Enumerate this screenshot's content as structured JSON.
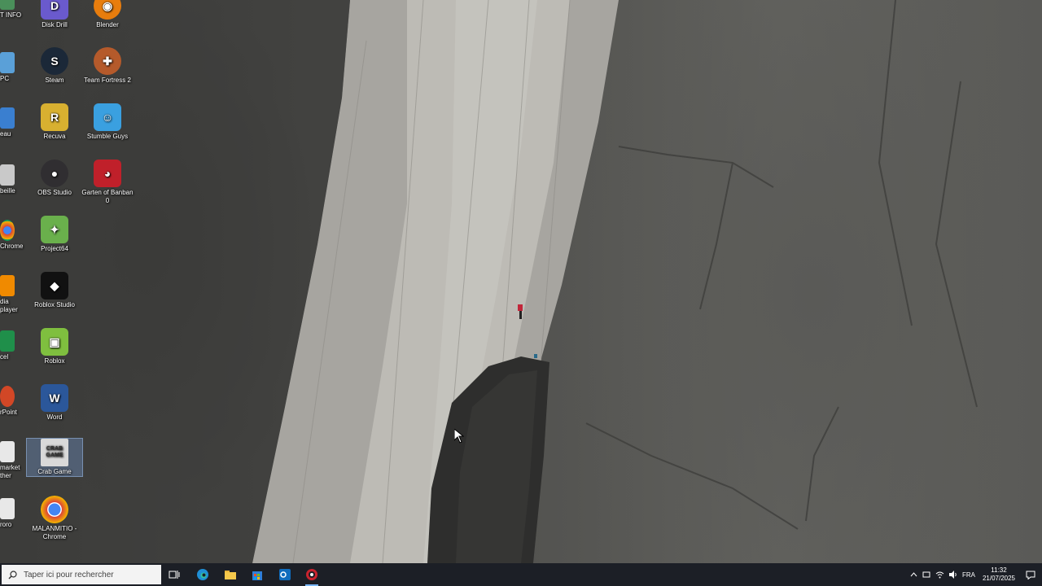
{
  "desktop": {
    "left_clipped": [
      {
        "label": "T INFO",
        "color": "#4a8f5a"
      },
      {
        "label": "PC",
        "color": "#5aa0d8"
      },
      {
        "label": "eau",
        "color": "#3a7fd0"
      },
      {
        "label": "beille",
        "color": "#c9c9c9"
      },
      {
        "label": "Chrome",
        "color": "#db4437"
      },
      {
        "label": "dia player",
        "color": "#f08a00"
      },
      {
        "label": "cel",
        "color": "#1f8f4a"
      },
      {
        "label": "rPoint",
        "color": "#d24726"
      },
      {
        "label": "market",
        "label2": "ther",
        "color": "#e8e8e8"
      },
      {
        "label": "roro",
        "color": "#e8e8e8"
      }
    ],
    "col1": [
      {
        "label": "Disk Drill",
        "glyph": "D",
        "color": "#6a5acd"
      },
      {
        "label": "Steam",
        "glyph": "S",
        "color": "#1b2838"
      },
      {
        "label": "Recuva",
        "glyph": "R",
        "color": "#d8b030"
      },
      {
        "label": "OBS Studio",
        "glyph": "●",
        "color": "#302e31"
      },
      {
        "label": "Project64",
        "glyph": "✦",
        "color": "#6ab04c"
      },
      {
        "label": "Roblox Studio",
        "glyph": "◆",
        "color": "#111111"
      },
      {
        "label": "Roblox",
        "glyph": "▣",
        "color": "#7fbf3f"
      },
      {
        "label": "Word",
        "glyph": "W",
        "color": "#2b579a"
      },
      {
        "label": "Crab Game",
        "glyph": "CRAB GAME",
        "color": "#d9d9d9"
      },
      {
        "label": "MALANMITIO - Chrome",
        "glyph": "●",
        "color": "#db4437"
      }
    ],
    "col2": [
      {
        "label": "Blender",
        "glyph": "◉",
        "color": "#e87d0d"
      },
      {
        "label": "Team Fortress 2",
        "glyph": "✚",
        "color": "#b55a2b"
      },
      {
        "label": "Stumble Guys",
        "glyph": "☺",
        "color": "#3aa0e0"
      },
      {
        "label": "Garten of Banban 0",
        "glyph": "◕",
        "color": "#c0202a"
      }
    ]
  },
  "taskbar": {
    "search_placeholder": "Taper ici pour rechercher",
    "language": "FRA",
    "time": "11:32",
    "date": "21/07/2025"
  }
}
